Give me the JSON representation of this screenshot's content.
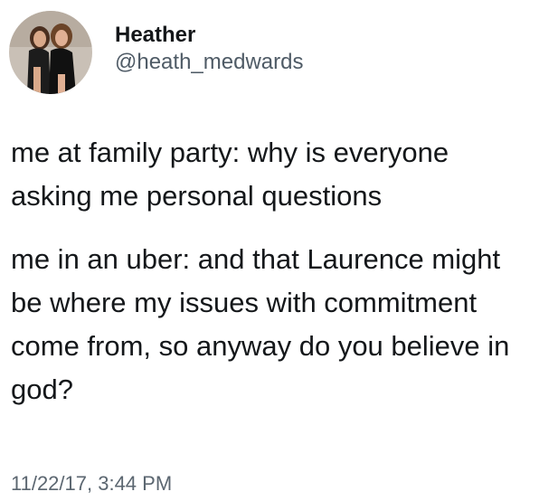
{
  "user": {
    "display_name": "Heather",
    "handle": "@heath_medwards",
    "avatar_icon": "profile-photo"
  },
  "tweet": {
    "paragraph_1": "me at family party: why is everyone asking me personal questions",
    "paragraph_2": "me in an uber: and that Laurence might be where my issues with commitment come from, so anyway do you believe in god?",
    "timestamp": "11/22/17, 3:44 PM"
  },
  "colors": {
    "text": "#14171a",
    "handle": "#4f5b66",
    "timestamp": "#5b6670",
    "background": "#ffffff"
  }
}
